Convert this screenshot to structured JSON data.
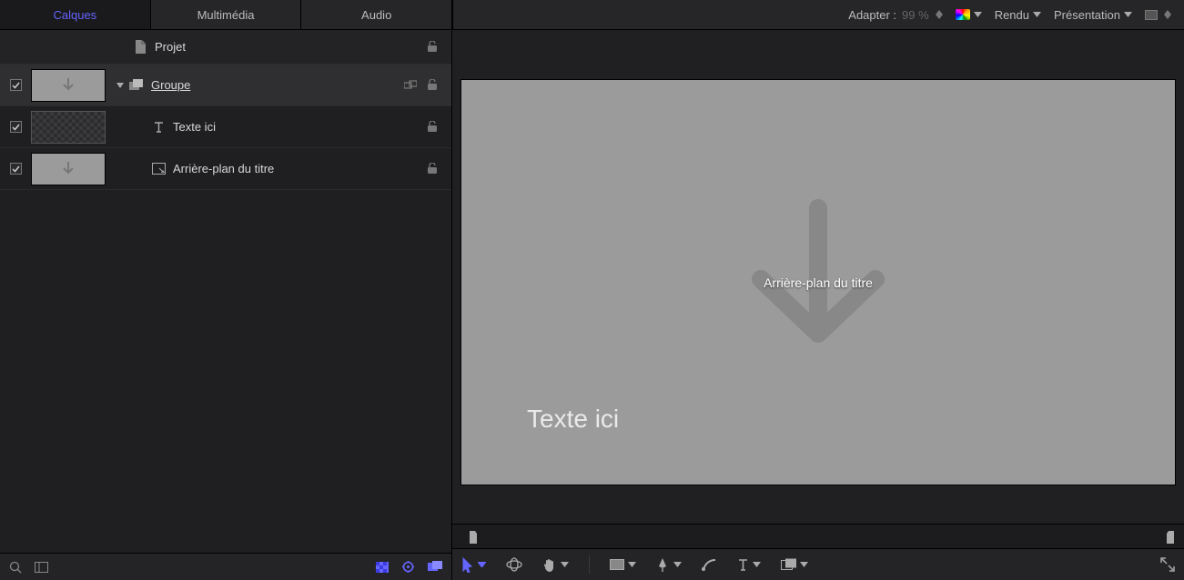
{
  "tabs": {
    "layers": "Calques",
    "media": "Multimédia",
    "audio": "Audio"
  },
  "topbar": {
    "fit_label": "Adapter :",
    "fit_value": "99 %",
    "render": "Rendu",
    "view": "Présentation"
  },
  "layers": {
    "project": "Projet",
    "group": "Groupe",
    "text_layer": "Texte ici",
    "title_bg": "Arrière-plan du titre"
  },
  "canvas": {
    "placeholder_label": "Arrière-plan du titre",
    "text_content": "Texte ici"
  }
}
